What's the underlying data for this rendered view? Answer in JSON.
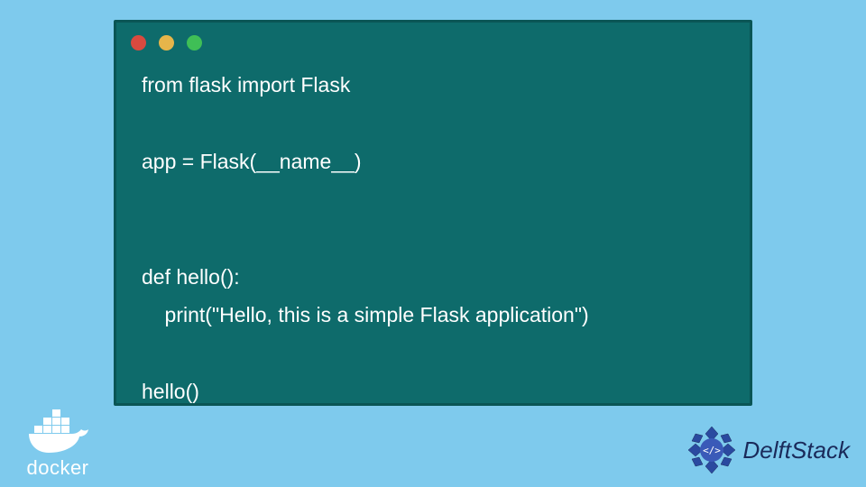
{
  "code": {
    "lines": [
      "from flask import Flask",
      "",
      "app = Flask(__name__)",
      "",
      "",
      "def hello():",
      "    print(\"Hello, this is a simple Flask application\")",
      "",
      "hello()"
    ]
  },
  "logos": {
    "docker": "docker",
    "delft_prefix": "Delft",
    "delft_suffix": "Stack"
  },
  "colors": {
    "background": "#7ecaed",
    "window": "#0e6b6b",
    "window_border": "#0a5555",
    "text": "#ffffff",
    "dot_red": "#d94a3f",
    "dot_yellow": "#e6b54a",
    "dot_green": "#3fbf56",
    "delft_text": "#1a2a5a"
  }
}
